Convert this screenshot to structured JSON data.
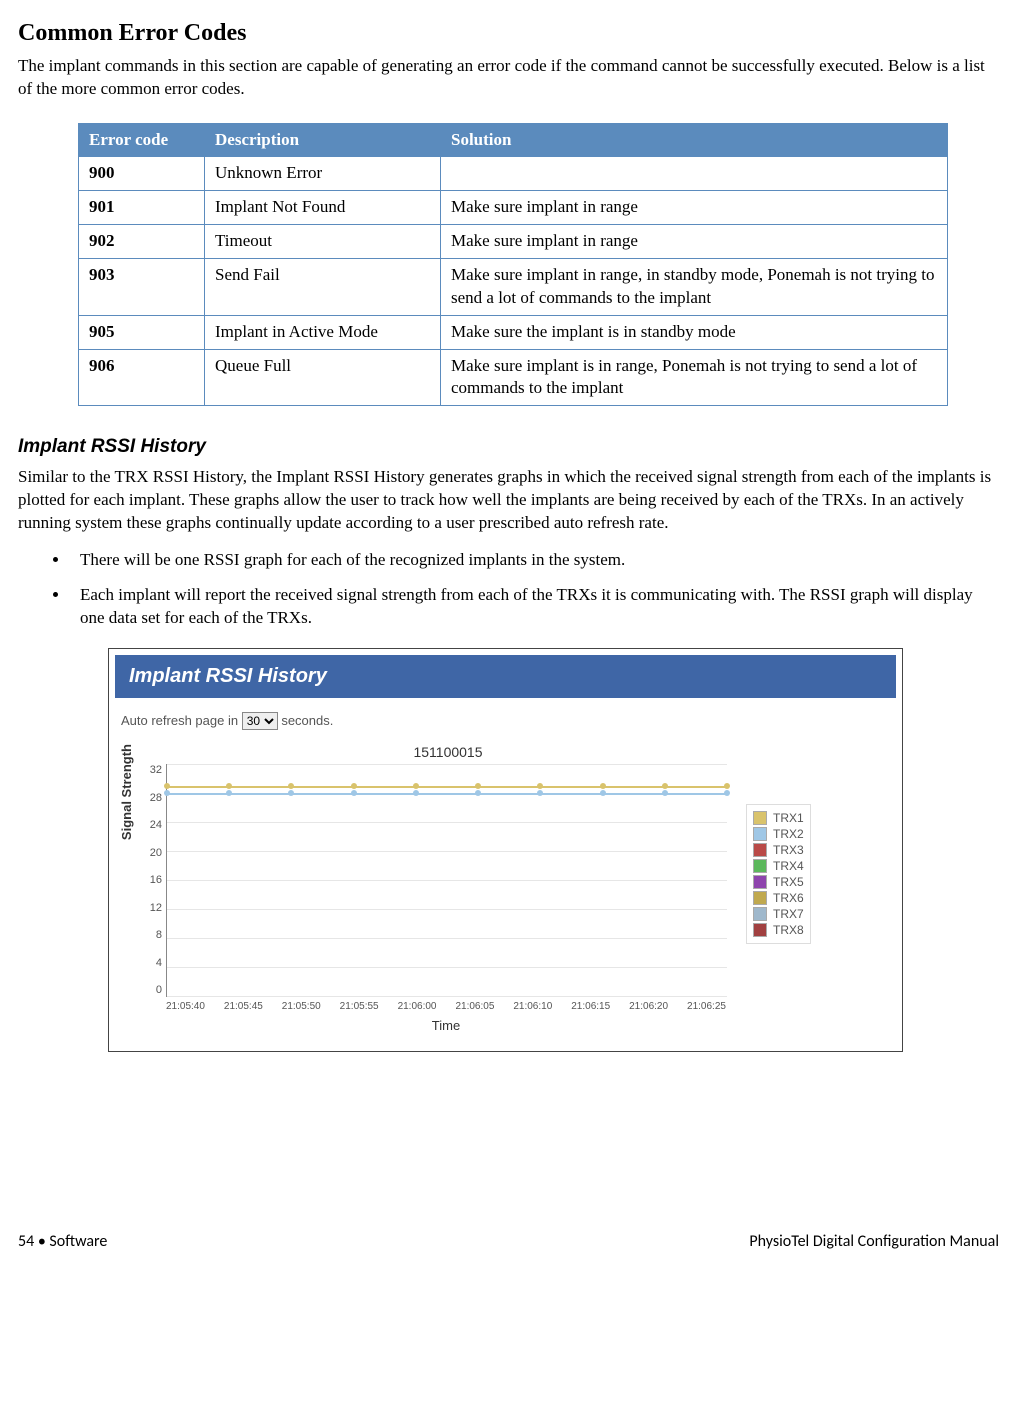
{
  "section1": {
    "title": "Common Error Codes",
    "intro": "The implant commands in this section are capable of generating an error code if the command cannot be successfully executed. Below is a list of the more common error codes."
  },
  "error_table": {
    "headers": {
      "code": "Error code",
      "desc": "Description",
      "sol": "Solution"
    },
    "rows": [
      {
        "code": "900",
        "desc": "Unknown Error",
        "sol": ""
      },
      {
        "code": "901",
        "desc": "Implant Not Found",
        "sol": "Make sure implant in range"
      },
      {
        "code": "902",
        "desc": "Timeout",
        "sol": "Make sure implant in range"
      },
      {
        "code": "903",
        "desc": "Send Fail",
        "sol": "Make sure implant in range, in standby mode, Ponemah is not trying to send a lot of commands to the implant"
      },
      {
        "code": "905",
        "desc": "Implant in Active Mode",
        "sol": "Make sure the implant is in standby mode"
      },
      {
        "code": "906",
        "desc": "Queue Full",
        "sol": "Make sure implant is in range, Ponemah is not trying to send a lot of commands to the implant"
      }
    ]
  },
  "section2": {
    "title": "Implant RSSI History",
    "para": "Similar to the TRX RSSI History, the Implant RSSI History generates graphs in which the received signal strength from each of the implants is plotted for each implant. These graphs allow the user to track how well the implants are being received by each of the TRXs.  In an actively running system these graphs continually update according to a user prescribed auto refresh rate.",
    "bullets": [
      "There will be one RSSI graph for each of the recognized implants in the system.",
      "Each implant will report the received signal strength from each of the TRXs it is communicating with. The RSSI graph will display one data set for each of the TRXs."
    ]
  },
  "rssi_panel": {
    "header": "Implant RSSI History",
    "refresh_prefix": "Auto refresh page in",
    "refresh_value": "30",
    "refresh_suffix": "seconds."
  },
  "chart_data": {
    "type": "line",
    "title": "151100015",
    "xlabel": "Time",
    "ylabel": "Signal Strength",
    "ylim": [
      0,
      32
    ],
    "yticks": [
      32,
      28,
      24,
      20,
      16,
      12,
      8,
      4,
      0
    ],
    "x": [
      "21:05:40",
      "21:05:45",
      "21:05:50",
      "21:05:55",
      "21:06:00",
      "21:06:05",
      "21:06:10",
      "21:06:15",
      "21:06:20",
      "21:06:25"
    ],
    "series": [
      {
        "name": "TRX1",
        "color": "#d9c36c",
        "values": [
          29,
          29,
          29,
          29,
          29,
          29,
          29,
          29,
          29,
          29
        ]
      },
      {
        "name": "TRX2",
        "color": "#9fc7e6",
        "values": [
          28,
          28,
          28,
          28,
          28,
          28,
          28,
          28,
          28,
          28
        ]
      },
      {
        "name": "TRX3",
        "color": "#b94a48",
        "values": null
      },
      {
        "name": "TRX4",
        "color": "#5cb85c",
        "values": null
      },
      {
        "name": "TRX5",
        "color": "#8e44ad",
        "values": null
      },
      {
        "name": "TRX6",
        "color": "#c0a94f",
        "values": null
      },
      {
        "name": "TRX7",
        "color": "#9fb8cc",
        "values": null
      },
      {
        "name": "TRX8",
        "color": "#a14040",
        "values": null
      }
    ]
  },
  "footer": {
    "left": "54  •  Software",
    "right": "PhysioTel Digital Configuration Manual"
  }
}
